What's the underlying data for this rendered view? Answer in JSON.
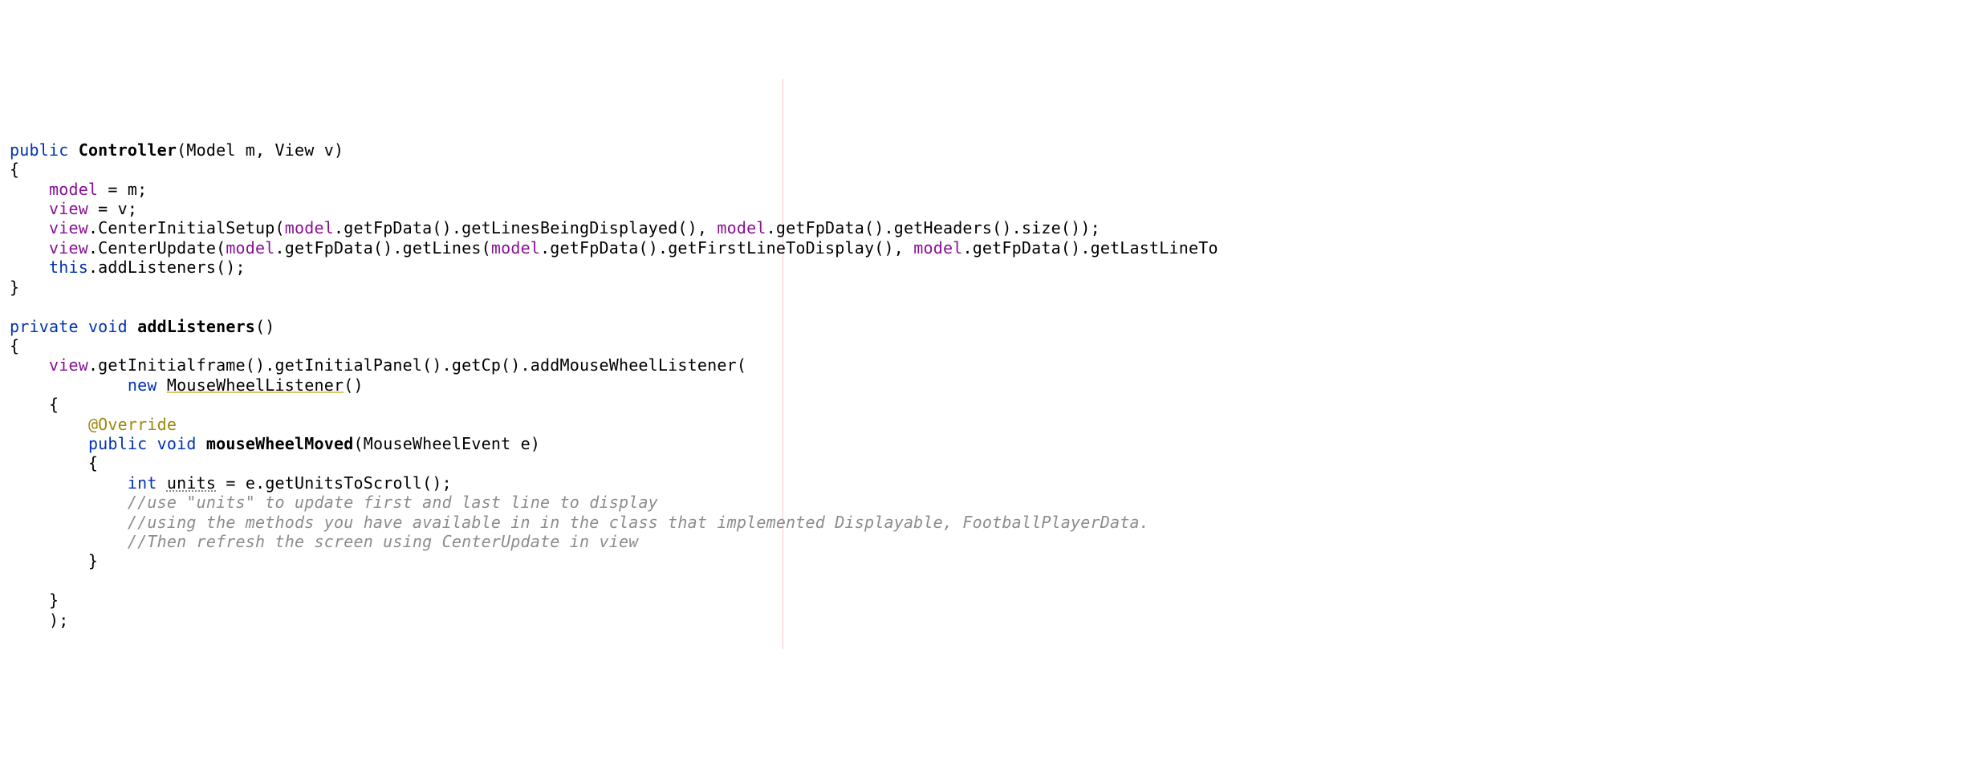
{
  "code": {
    "line1_public": "public",
    "line1_ctor": "Controller",
    "line1_params": "(Model m, View v)",
    "line2": "{",
    "line3_model": "model",
    "line3_eq": " = m;",
    "line4_view": "view",
    "line4_eq": " = v;",
    "line5_view": "view",
    "line5_a": ".CenterInitialSetup(",
    "line5_model1": "model",
    "line5_b": ".getFpData().getLinesBeingDisplayed(), ",
    "line5_model2": "model",
    "line5_c": ".getFpData().getHeaders().size());",
    "line6_view": "view",
    "line6_a": ".CenterUpdate(",
    "line6_model1": "model",
    "line6_b": ".getFpData().getLines(",
    "line6_model2": "model",
    "line6_c": ".getFpData().getFirstLineToDisplay(), ",
    "line6_model3": "model",
    "line6_d": ".getFpData().getLastLineTo",
    "line7_this": "this",
    "line7_rest": ".addListeners();",
    "line8": "}",
    "line9": "",
    "line10_private": "private",
    "line10_void": "void",
    "line10_method": "addListeners",
    "line10_parens": "()",
    "line11": "{",
    "line12_view": "view",
    "line12_rest": ".getInitialframe().getInitialPanel().getCp().addMouseWheelListener(",
    "line13_new": "new",
    "line13_cls": "MouseWheelListener",
    "line13_parens": "()",
    "line14": "    {",
    "line15_annot": "@Override",
    "line16_public": "public",
    "line16_void": "void",
    "line16_method": "mouseWheelMoved",
    "line16_params": "(MouseWheelEvent e)",
    "line17": "        {",
    "line18_int": "int",
    "line18_var": "units",
    "line18_rest": " = e.getUnitsToScroll();",
    "line19_cmt": "//use \"units\" to update first and last line to display",
    "line20_cmt": "//using the methods you have available in in the class that implemented Displayable, FootballPlayerData.",
    "line21_cmt": "//Then refresh the screen using CenterUpdate in view",
    "line22": "        }",
    "line23": "",
    "line24": "    }",
    "line25": "    );"
  }
}
